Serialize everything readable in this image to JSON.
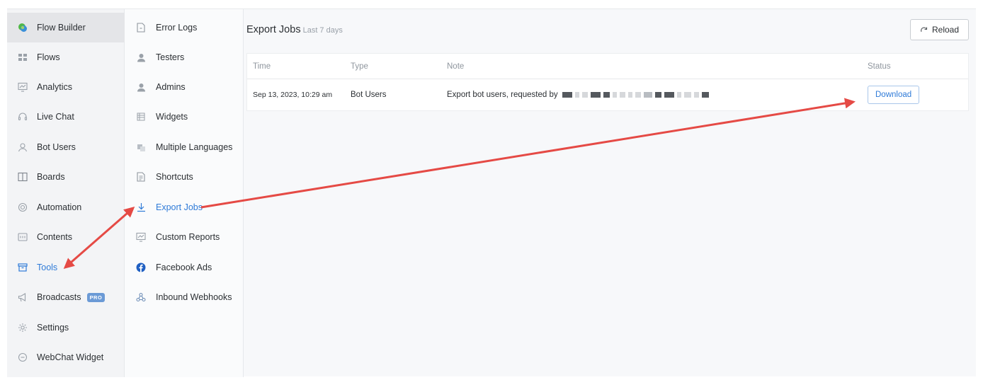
{
  "nav": {
    "items": [
      {
        "label": "Flow Builder",
        "icon": "flow-builder-icon"
      },
      {
        "label": "Flows",
        "icon": "flows-icon"
      },
      {
        "label": "Analytics",
        "icon": "analytics-icon"
      },
      {
        "label": "Live Chat",
        "icon": "headset-icon"
      },
      {
        "label": "Bot Users",
        "icon": "user-icon"
      },
      {
        "label": "Boards",
        "icon": "boards-icon"
      },
      {
        "label": "Automation",
        "icon": "automation-icon"
      },
      {
        "label": "Contents",
        "icon": "contents-icon"
      },
      {
        "label": "Tools",
        "icon": "toolbox-icon"
      },
      {
        "label": "Broadcasts",
        "icon": "megaphone-icon",
        "badge": "PRO"
      },
      {
        "label": "Settings",
        "icon": "gear-icon"
      },
      {
        "label": "WebChat Widget",
        "icon": "chat-bubble-icon"
      }
    ],
    "selected": "Flow Builder",
    "active": "Tools"
  },
  "subnav": {
    "items": [
      {
        "label": "Error Logs",
        "icon": "document-icon"
      },
      {
        "label": "Testers",
        "icon": "person-icon"
      },
      {
        "label": "Admins",
        "icon": "admin-icon"
      },
      {
        "label": "Widgets",
        "icon": "widgets-icon"
      },
      {
        "label": "Multiple Languages",
        "icon": "translate-icon"
      },
      {
        "label": "Shortcuts",
        "icon": "shortcut-icon"
      },
      {
        "label": "Export Jobs",
        "icon": "download-icon"
      },
      {
        "label": "Custom Reports",
        "icon": "report-icon"
      },
      {
        "label": "Facebook Ads",
        "icon": "facebook-icon"
      },
      {
        "label": "Inbound Webhooks",
        "icon": "webhook-icon"
      }
    ],
    "active": "Export Jobs"
  },
  "main": {
    "title": "Export Jobs",
    "subtitle": "Last 7 days",
    "reload_label": "Reload",
    "table": {
      "headers": {
        "time": "Time",
        "type": "Type",
        "note": "Note",
        "status": "Status"
      },
      "rows": [
        {
          "time": "Sep 13, 2023, 10:29 am",
          "type": "Bot Users",
          "note": "Export bot users, requested by",
          "status": "Download"
        }
      ]
    }
  },
  "colors": {
    "accent": "#2f7bd8",
    "annotation_arrow": "#e54a45",
    "pro_badge": "#6b9ad6"
  }
}
